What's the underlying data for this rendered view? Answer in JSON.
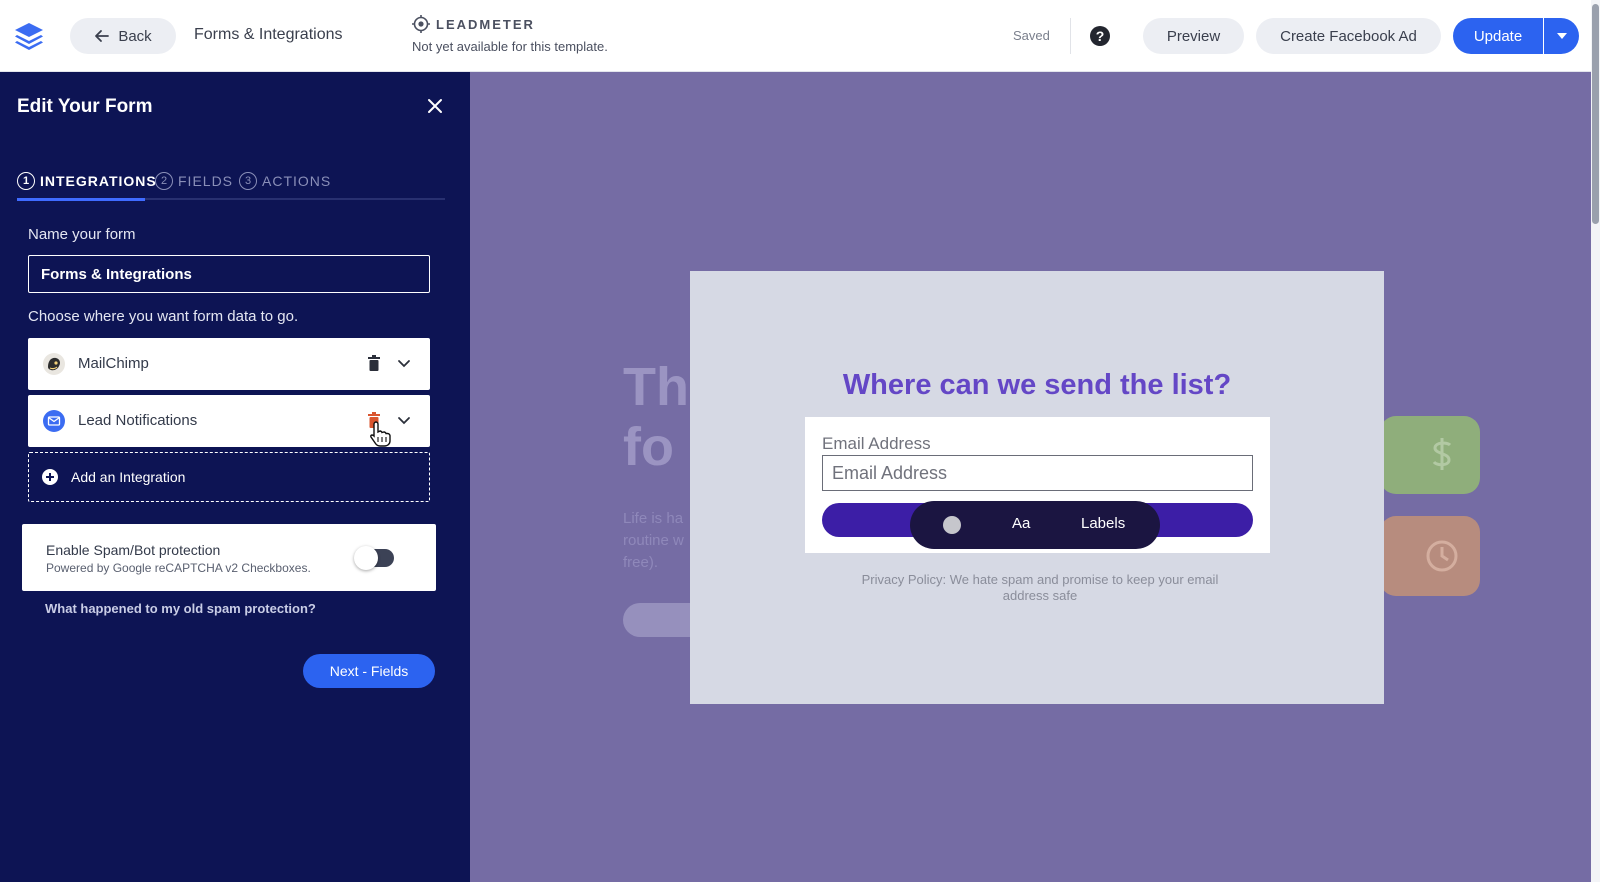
{
  "topbar": {
    "back_label": "Back",
    "page_name": "Forms & Integrations",
    "leadmeter_title": "LEADMETER",
    "leadmeter_subtitle": "Not yet available for this template.",
    "saved_label": "Saved",
    "preview_label": "Preview",
    "facebook_ad_label": "Create Facebook Ad",
    "update_label": "Update"
  },
  "panel": {
    "title": "Edit Your Form",
    "steps": [
      {
        "num": "1",
        "label": "INTEGRATIONS",
        "active": true
      },
      {
        "num": "2",
        "label": "FIELDS",
        "active": false
      },
      {
        "num": "3",
        "label": "ACTIONS",
        "active": false
      }
    ],
    "name_label": "Name your form",
    "name_value": "Forms & Integrations",
    "choose_text": "Choose where you want form data to go.",
    "integrations": [
      {
        "label": "MailChimp",
        "icon": "mailchimp-icon"
      },
      {
        "label": "Lead Notifications",
        "icon": "email-icon"
      }
    ],
    "add_integration_label": "Add an Integration",
    "spam_title": "Enable Spam/Bot protection",
    "spam_subtitle": "Powered by Google reCAPTCHA v2 Checkboxes.",
    "spam_enabled": false,
    "old_spam_link": "What happened to my old spam protection?",
    "next_label": "Next - Fields"
  },
  "canvas": {
    "bg_heading_lines": [
      "Th",
      "fo"
    ],
    "bg_body_lines": [
      "Life is ha",
      "routine w",
      "free)."
    ],
    "modal": {
      "title": "Where can we send the list?",
      "email_label": "Email Address",
      "email_placeholder": "Email Address",
      "toolbar_aa": "Aa",
      "toolbar_labels": "Labels",
      "privacy_line1": "Privacy Policy: We hate spam and promise to keep your email",
      "privacy_line2": "address safe"
    }
  },
  "colors": {
    "panel_bg": "#0d1454",
    "accent_blue": "#2c63f0",
    "canvas_bg": "#756ca4",
    "modal_title": "#6447c6",
    "submit_bar": "#3c1ea6",
    "trash_highlight": "#d9552f"
  }
}
